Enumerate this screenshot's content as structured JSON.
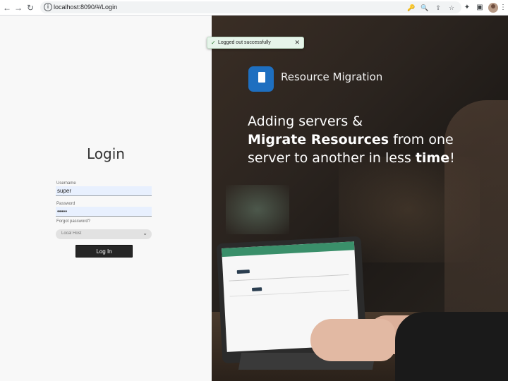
{
  "browser": {
    "url": "localhost:8090/#/Login",
    "icons": {
      "back": "←",
      "forward": "→",
      "reload": "↻",
      "info": "i",
      "key": "🔑",
      "zoom": "🔍",
      "share": "⇪",
      "star": "☆",
      "extensions": "✦",
      "sidebar": "▣",
      "menu": "⋮"
    }
  },
  "login": {
    "title": "Login",
    "username_label": "Username",
    "username_value": "super",
    "password_label": "Password",
    "password_value": "•••••",
    "forgot_label": "Forgot password?",
    "server_select": "Local Host",
    "chevron": "⌄",
    "button_label": "Log In"
  },
  "hero": {
    "brand_name": "Resource Migration",
    "headline": {
      "line1": "Adding servers &",
      "line2_bold": "Migrate Resources",
      "line2_rest": " from one",
      "line3_start": "server to another in less ",
      "line3_bold": "time",
      "line3_end": "!"
    }
  },
  "toast": {
    "check": "✓",
    "message": "Logged out successfully",
    "close": "✕"
  },
  "colors": {
    "brand_blue": "#1e6fc0",
    "toast_bg": "#e6f4ea",
    "button_dark": "#262626",
    "input_bg": "#e8f0fe"
  }
}
